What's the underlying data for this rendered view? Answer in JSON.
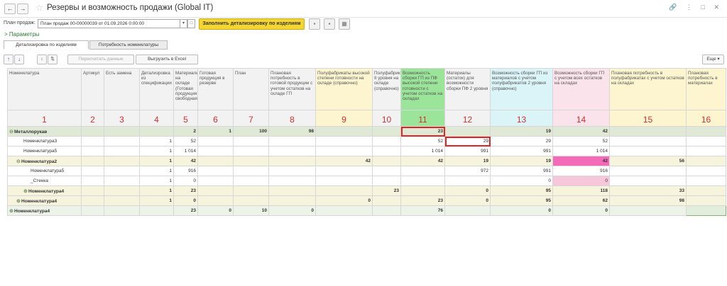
{
  "window": {
    "title": "Резервы и возможность продажи (Global IT)",
    "back_icon": "←",
    "forward_icon": "→",
    "star_icon": "☆",
    "top_icons": "🔗 ⋮ □ ✕"
  },
  "filter": {
    "label": "План продаж:",
    "value": "План продаж 00-00000039 от 01.09.2026 0:00:00",
    "dropdown_icon": "▾",
    "open_icon": "□",
    "fill_button": "Заполнить детализировку по изделиям"
  },
  "params_label": "> Параметры",
  "tabs": [
    {
      "label": "Детализировка по изделиям"
    },
    {
      "label": "Потребность номенклатуры"
    }
  ],
  "toolbar": {
    "up_icon": "↑",
    "down_icon": "↓",
    "sort_asc_icon": "↕",
    "sort_desc_icon": "⇅",
    "recalc_button": "Пересчитать данные",
    "export_button": "Выгрузить в Excel",
    "more_button": "Еще ▾"
  },
  "headers": [
    "Номенклатура",
    "Артикул",
    "Есть замена",
    "Детализровка из спецификации",
    "Материалы на складе (Готовая продукция свободная)",
    "Готовая продукция в резерве",
    "План",
    "Плановая потребность в готовой продукции с учетом остатков на складе ГП",
    "Полуфабрикаты высокой степени готовности на складе (справочно)",
    "Полуфабрикаты II уровня на складе (справочно)",
    "Возможность сборки ГП из ПФ высокой степени готовности с учетом остатков на складах",
    "Материалы (остаток) для возможности сборки ПФ 2 уровня",
    "Возможность сборки ГП из материалов с учетом полуфабрикатов 2 уровня (справочно)",
    "Возможность сборки ГП с учетом всех остатков на складах",
    "Плановая потребность в полуфабрикатах с учетом остатков на складах",
    "Плановая потребность в материалах"
  ],
  "column_numbers": [
    "1",
    "2",
    "3",
    "4",
    "5",
    "6",
    "7",
    "8",
    "9",
    "10",
    "11",
    "12",
    "13",
    "14",
    "15",
    "16"
  ],
  "rows": [
    {
      "name": "Металлорукав",
      "cells": [
        "",
        "",
        "",
        "2",
        "1",
        "100",
        "98",
        "",
        "",
        "23",
        "",
        "19",
        "42",
        "",
        ""
      ]
    },
    {
      "name": "Номенклатура3",
      "cells": [
        "",
        "",
        "1",
        "52",
        "",
        "",
        "",
        "",
        "",
        "52",
        "29",
        "29",
        "52",
        "",
        ""
      ]
    },
    {
      "name": "Номенклатура5",
      "cells": [
        "",
        "",
        "1",
        "1 014",
        "",
        "",
        "",
        "",
        "",
        "1 014",
        "991",
        "991",
        "1 014",
        "",
        ""
      ]
    },
    {
      "name": "Номенклатура2",
      "cells": [
        "",
        "",
        "1",
        "42",
        "",
        "",
        "",
        "42",
        "",
        "42",
        "19",
        "19",
        "42",
        "56",
        ""
      ]
    },
    {
      "name": "Номенклатура5",
      "cells": [
        "",
        "",
        "1",
        "916",
        "",
        "",
        "",
        "",
        "",
        "",
        "972",
        "991",
        "916",
        "",
        ""
      ]
    },
    {
      "name": "_Стенка",
      "cells": [
        "",
        "",
        "1",
        "0",
        "",
        "",
        "",
        "",
        "",
        "",
        "",
        "0",
        "0",
        "",
        ""
      ]
    },
    {
      "name": "Номенклатура4",
      "cells": [
        "",
        "",
        "1",
        "23",
        "",
        "",
        "",
        "",
        "23",
        "",
        "0",
        "95",
        "118",
        "33",
        ""
      ]
    },
    {
      "name": "Номенклатура4",
      "cells": [
        "",
        "",
        "1",
        "0",
        "",
        "",
        "",
        "0",
        "",
        "23",
        "0",
        "95",
        "62",
        "98",
        ""
      ]
    },
    {
      "name": "Номенклатура4",
      "cells": [
        "",
        "",
        "",
        "23",
        "0",
        "10",
        "0",
        "",
        "",
        "76",
        "",
        "0",
        "0",
        "",
        ""
      ]
    }
  ]
}
